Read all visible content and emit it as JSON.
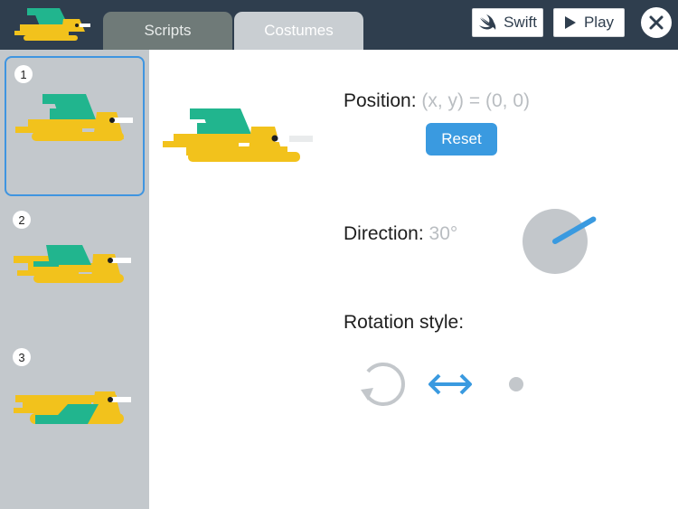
{
  "app": {
    "logo_icon": "bird-logo-icon"
  },
  "tabs": [
    {
      "label": "Scripts",
      "active": false
    },
    {
      "label": "Costumes",
      "active": true
    }
  ],
  "toolbar": {
    "swift_label": "Swift",
    "swift_icon": "swift-logo-icon",
    "play_label": "Play",
    "play_icon": "play-icon",
    "close_icon": "close-icon"
  },
  "costumes": [
    {
      "number": "1",
      "selected": true,
      "pose": "wings-up"
    },
    {
      "number": "2",
      "selected": false,
      "pose": "wings-mid"
    },
    {
      "number": "3",
      "selected": false,
      "pose": "wings-down"
    }
  ],
  "position": {
    "label": "Position:",
    "value": "(x, y) = (0, 0)",
    "reset_label": "Reset"
  },
  "direction": {
    "label": "Direction:",
    "value": "30°",
    "degrees": 30
  },
  "rotation_style": {
    "label": "Rotation style:",
    "options": [
      {
        "icon": "rotate-all-around-icon",
        "active": false
      },
      {
        "icon": "left-right-arrow-icon",
        "active": true
      },
      {
        "icon": "dont-rotate-dot-icon",
        "active": false
      }
    ]
  },
  "colors": {
    "topbar": "#2f3e4e",
    "accent": "#3a9ae0",
    "bird_body": "#f2c21c",
    "bird_wing": "#21b58e",
    "sidebar": "#c3c8cc"
  }
}
